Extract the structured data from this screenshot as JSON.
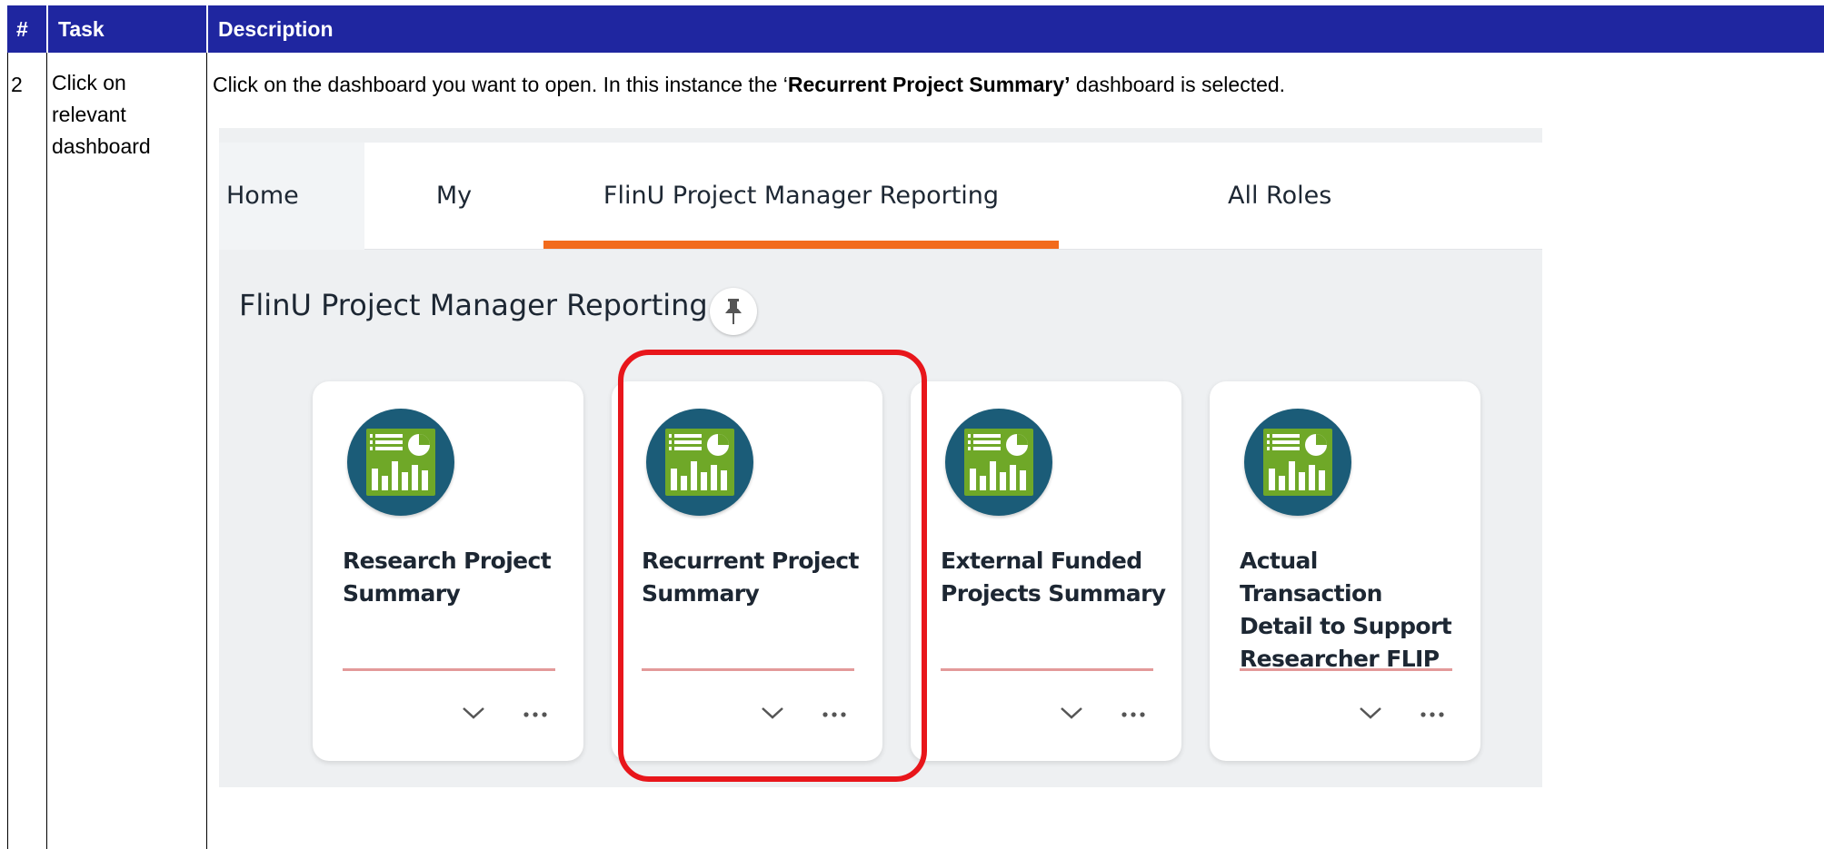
{
  "table": {
    "headers": [
      "#",
      "Task",
      "Description"
    ],
    "row": {
      "num": "2",
      "task": "Click on relevant dashboard",
      "description_pre": "Click on the dashboard you want to open. In this instance the ‘",
      "description_bold": "Recurrent Project Summary’",
      "description_post": " dashboard is selected."
    }
  },
  "screenshot": {
    "nav_tabs": [
      {
        "label": "Home",
        "active": false
      },
      {
        "label": "My",
        "active": false
      },
      {
        "label": "FlinU Project Manager Reporting",
        "active": true
      },
      {
        "label": "All Roles",
        "active": false
      }
    ],
    "group_title": "FlinU Project Manager Reporting",
    "tiles": [
      {
        "title_line1": "Research Project",
        "title_line2": "Summary",
        "title_line3": ""
      },
      {
        "title_line1": "Recurrent Project",
        "title_line2": "Summary",
        "title_line3": "",
        "highlighted": true
      },
      {
        "title_line1": "External Funded",
        "title_line2": "Projects Summary",
        "title_line3": ""
      },
      {
        "title_line1": "Actual Transaction",
        "title_line2": "Detail to Support",
        "title_line3": "Researcher FLIP"
      }
    ],
    "icons": {
      "tile_icon": "dashboard-chart-icon",
      "pin": "pin-icon",
      "expand": "chevron-down-icon",
      "more": "more-dots-icon"
    },
    "colors": {
      "header_bg": "#1f26a0",
      "tab_underline": "#f26b1d",
      "tile_icon_bg": "#1b5c78",
      "tile_icon_fg": "#6fa828",
      "highlight": "#e8161b"
    }
  }
}
